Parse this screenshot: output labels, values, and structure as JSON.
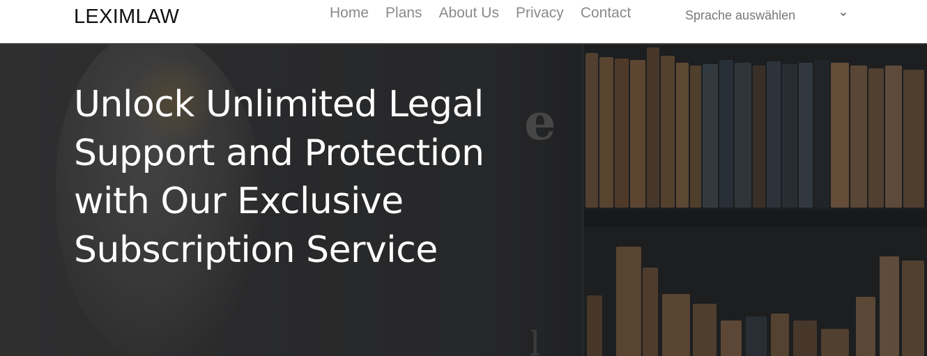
{
  "header": {
    "brand": "LEXIMLAW",
    "nav": [
      {
        "label": "Home"
      },
      {
        "label": "Plans"
      },
      {
        "label": "About Us"
      },
      {
        "label": "Privacy"
      },
      {
        "label": "Contact"
      }
    ],
    "language_select": {
      "value": "Sprache auswählen",
      "icon": "chevron-down-icon"
    }
  },
  "hero": {
    "headline": "Unlock Unlimited Legal Support and Protection with Our Exclusive Subscription Service",
    "background_image": "law-library-bookshelf-with-statue"
  },
  "colors": {
    "header_bg": "#ffffff",
    "brand_text": "#111111",
    "nav_text": "#8a8a8a",
    "hero_bg": "#2b2b2c",
    "headline_text": "#ffffff"
  }
}
